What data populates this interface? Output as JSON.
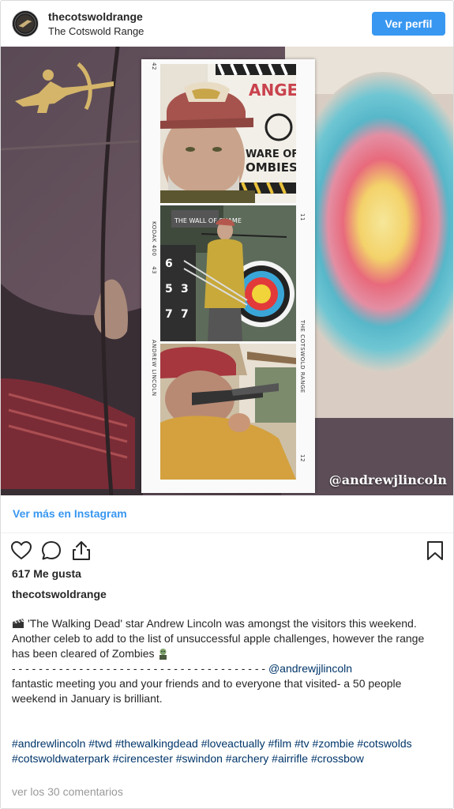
{
  "header": {
    "username": "thecotswoldrange",
    "full_name": "The Cotswold Range",
    "profile_button": "Ver perfil"
  },
  "media": {
    "watermark": "@andrewjlincoln",
    "strip_edge_top": "42",
    "strip_edge_kodak": "KODAK 400",
    "strip_edge_43": "43",
    "strip_edge_name": "ANDREW LINCOLN",
    "strip_edge_11": "11",
    "strip_edge_range": "THE COTSWOLD RANGE",
    "strip_edge_12": "12",
    "sign_text_1": "ANGER",
    "sign_text_2": "WARE OF",
    "sign_text_3": "OMBIES",
    "sign_text_4": "THE WALL OF SHAME",
    "target_numbers": [
      "6",
      "5",
      "3",
      "7",
      "7"
    ]
  },
  "view_more": "Ver más en Instagram",
  "actions": {
    "like_icon": "heart-icon",
    "comment_icon": "comment-icon",
    "share_icon": "share-icon",
    "save_icon": "bookmark-icon"
  },
  "likes": "617 Me gusta",
  "author": "thecotswoldrange",
  "caption": {
    "line1": "'The Walking Dead' star Andrew Lincoln was amongst the visitors this weekend.",
    "line2": "Another celeb to add to the list of unsuccessful apple challenges, however the range has been cleared of Zombies",
    "dashes": "- - - - - - - - - - - - - - - - - - - - - - - - - - - - - - - - - - - - - -",
    "mention": "@andrewjjlincoln",
    "line3": "fantastic meeting you and your friends and to everyone that visited- a 50 people weekend in January is brilliant."
  },
  "hashtags": "#andrewlincoln #twd #thewalkingdead #loveactually #film #tv #zombie #cotswolds #cotswoldwaterpark #cirencester #swindon #archery #airrifle #crossbow",
  "comments_link": "ver los 30 comentarios",
  "colors": {
    "accent": "#3897f0",
    "hashtag": "#003569",
    "muted": "#999999"
  }
}
